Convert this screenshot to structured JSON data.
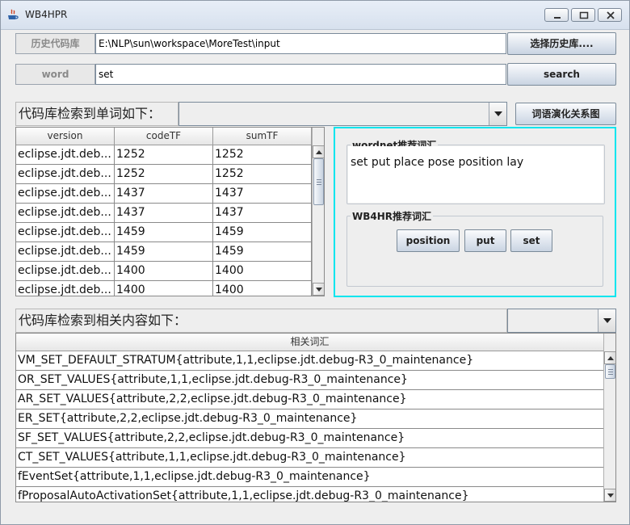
{
  "window": {
    "title": "WB4HPR"
  },
  "repo": {
    "label": "历史代码库",
    "path": "E:\\NLP\\sun\\workspace\\MoreTest\\input",
    "choose_button": "选择历史库...."
  },
  "word": {
    "label": "word",
    "value": "set",
    "search_button": "search"
  },
  "words_section": {
    "caption": "代码库检索到单词如下：",
    "combo_value": "",
    "graph_button": "词语演化关系图"
  },
  "words_table": {
    "columns": [
      "version",
      "codeTF",
      "sumTF"
    ],
    "rows": [
      [
        "eclipse.jdt.deb...",
        "1252",
        "1252"
      ],
      [
        "eclipse.jdt.deb...",
        "1252",
        "1252"
      ],
      [
        "eclipse.jdt.deb...",
        "1437",
        "1437"
      ],
      [
        "eclipse.jdt.deb...",
        "1437",
        "1437"
      ],
      [
        "eclipse.jdt.deb...",
        "1459",
        "1459"
      ],
      [
        "eclipse.jdt.deb...",
        "1459",
        "1459"
      ],
      [
        "eclipse.jdt.deb...",
        "1400",
        "1400"
      ],
      [
        "eclipse.jdt.deb...",
        "1400",
        "1400"
      ]
    ]
  },
  "wordnet": {
    "title": "wordnet推荐词汇",
    "text": "set put place pose position lay"
  },
  "wb4hr": {
    "title": "WB4HR推荐词汇",
    "buttons": [
      "position",
      "put",
      "set"
    ]
  },
  "related_section": {
    "caption": "代码库检索到相关内容如下：",
    "combo_value": ""
  },
  "related_table": {
    "column": "相关词汇",
    "rows": [
      "VM_SET_DEFAULT_STRATUM{attribute,1,1,eclipse.jdt.debug-R3_0_maintenance}",
      "OR_SET_VALUES{attribute,1,1,eclipse.jdt.debug-R3_0_maintenance}",
      "AR_SET_VALUES{attribute,2,2,eclipse.jdt.debug-R3_0_maintenance}",
      "ER_SET{attribute,2,2,eclipse.jdt.debug-R3_0_maintenance}",
      "SF_SET_VALUES{attribute,2,2,eclipse.jdt.debug-R3_0_maintenance}",
      "CT_SET_VALUES{attribute,1,1,eclipse.jdt.debug-R3_0_maintenance}",
      "fEventSet{attribute,1,1,eclipse.jdt.debug-R3_0_maintenance}",
      "fProposalAutoActivationSet{attribute,1,1,eclipse.jdt.debug-R3_0_maintenance}"
    ]
  },
  "colors": {
    "panel_border": "#00e5ee",
    "button_top": "#fafbfd",
    "button_bottom": "#c9d4e2"
  }
}
